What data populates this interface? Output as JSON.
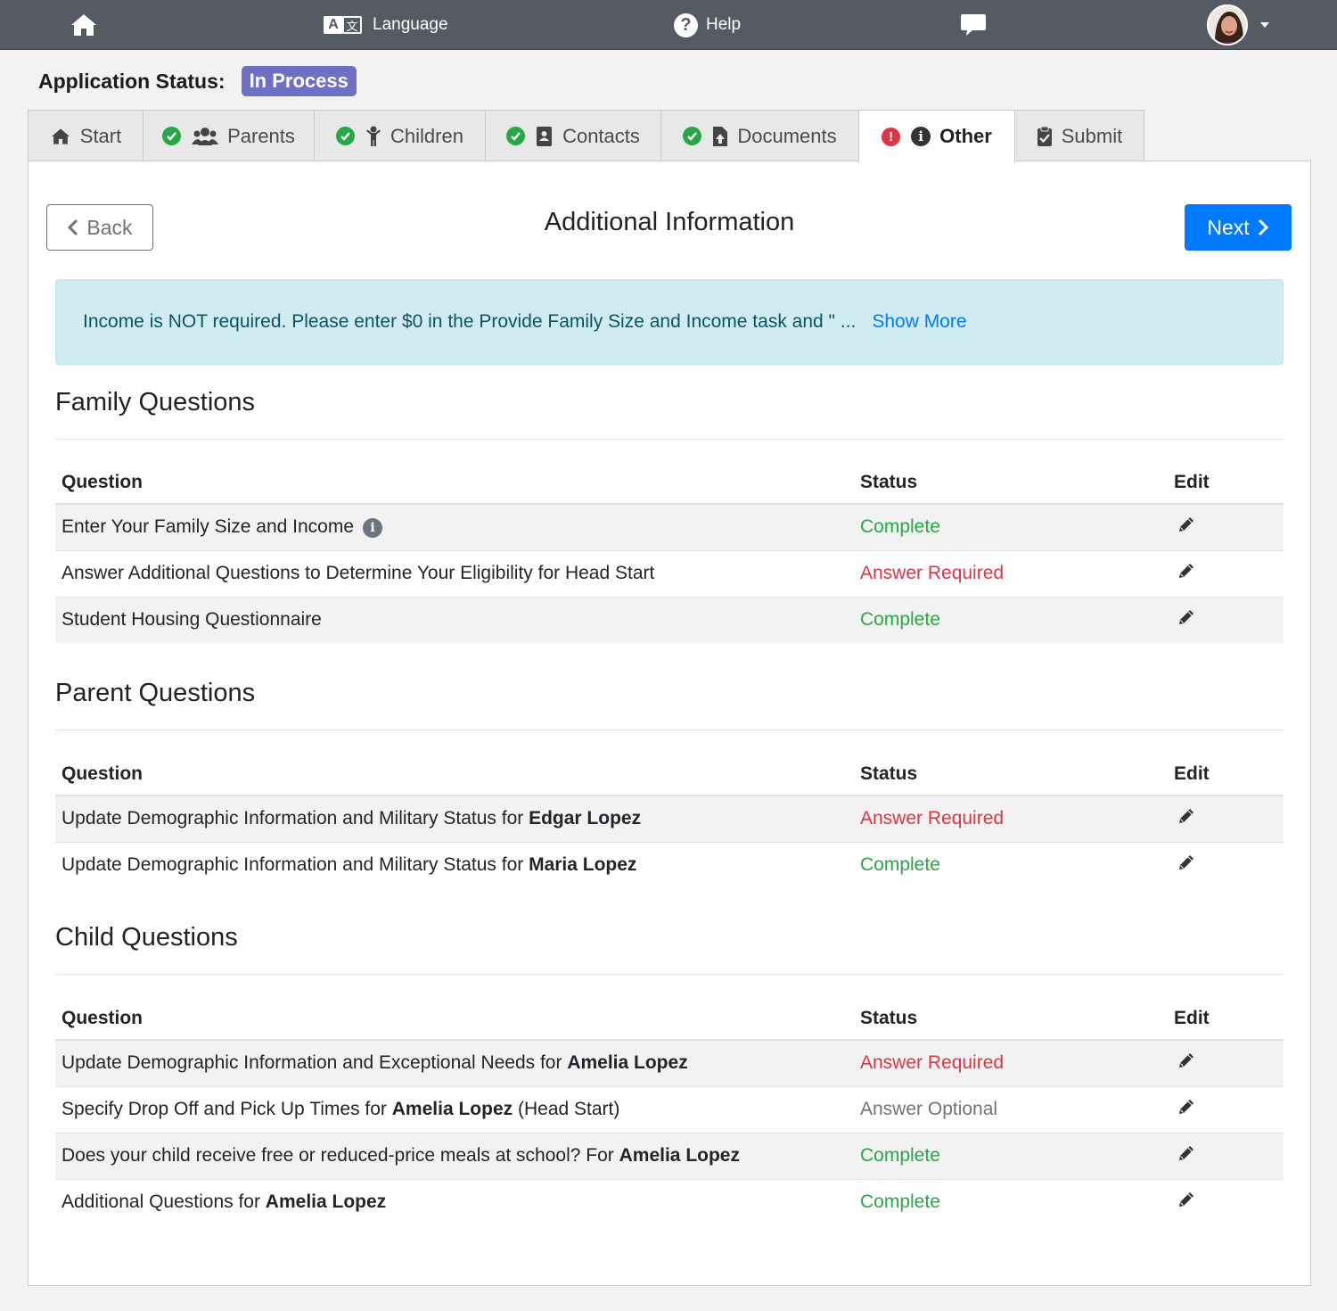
{
  "nav": {
    "language": "Language",
    "lang_a": "A",
    "lang_b": "文",
    "help": "Help",
    "help_glyph": "?"
  },
  "status": {
    "label": "Application Status:",
    "badge": "In Process"
  },
  "tabs": [
    {
      "label": "Start",
      "state": "none",
      "icon": "home-icon"
    },
    {
      "label": "Parents",
      "state": "complete",
      "icon": "users-icon"
    },
    {
      "label": "Children",
      "state": "complete",
      "icon": "child-icon"
    },
    {
      "label": "Contacts",
      "state": "complete",
      "icon": "address-book-icon"
    },
    {
      "label": "Documents",
      "state": "complete",
      "icon": "file-upload-icon"
    },
    {
      "label": "Other",
      "state": "alert",
      "icon": "info-icon",
      "active": true
    },
    {
      "label": "Submit",
      "state": "none",
      "icon": "clipboard-check-icon"
    }
  ],
  "page": {
    "back": "Back",
    "next": "Next",
    "title": "Additional Information",
    "alert_text": "Income is NOT required. Please enter $0 in the Provide Family Size and Income task and \" ...",
    "show_more": "Show More"
  },
  "table_headers": {
    "question": "Question",
    "status": "Status",
    "edit": "Edit"
  },
  "sections": {
    "family": {
      "title": "Family Questions",
      "rows": [
        {
          "q": "Enter Your Family Size and Income",
          "status": "Complete"
        },
        {
          "q": "Answer Additional Questions to Determine Your Eligibility for Head Start",
          "status": "Answer Required"
        },
        {
          "q": "Student Housing Questionnaire",
          "status": "Complete"
        }
      ]
    },
    "parent": {
      "title": "Parent Questions",
      "rows": [
        {
          "q": "Update Demographic Information and Military Status for ",
          "name": "Edgar Lopez",
          "status": "Answer Required"
        },
        {
          "q": "Update Demographic Information and Military Status for ",
          "name": "Maria Lopez",
          "status": "Complete"
        }
      ]
    },
    "child": {
      "title": "Child Questions",
      "rows": [
        {
          "q": "Update Demographic Information and Exceptional Needs for ",
          "name": "Amelia Lopez",
          "status": "Answer Required"
        },
        {
          "q": "Specify Drop Off and Pick Up Times for ",
          "name": "Amelia Lopez",
          "suffix": " (Head Start)",
          "status": "Answer Optional"
        },
        {
          "q": "Does your child receive free or reduced-price meals at school? For ",
          "name": "Amelia Lopez",
          "status": "Complete"
        },
        {
          "q": "Additional Questions for ",
          "name": "Amelia Lopez",
          "status": "Complete"
        }
      ]
    }
  },
  "colors": {
    "nav_bg": "#565a63",
    "badge": "#6f6fc4",
    "primary": "#007bff",
    "complete": "#28a745",
    "required": "#dc3545",
    "optional": "#6c757d",
    "alert_bg": "#d1ecf1"
  }
}
